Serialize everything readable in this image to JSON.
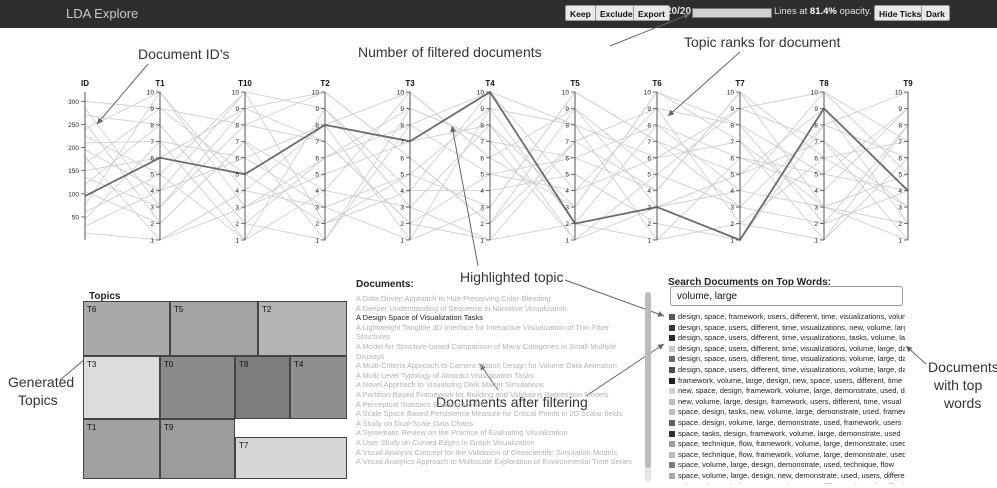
{
  "header": {
    "app_title": "LDA Explore",
    "keep_label": "Keep",
    "exclude_label": "Exclude",
    "export_label": "Export",
    "filter_count": "20/20",
    "filter_fraction": 1.0,
    "opacity_prefix": "Lines at ",
    "opacity_value": "81.4%",
    "opacity_suffix": " opacity.",
    "hide_ticks_label": "Hide Ticks",
    "dark_label": "Dark"
  },
  "annotations": {
    "document_ids": "Document ID’s",
    "filtered_documents": "Number of filtered documents",
    "topic_ranks": "Topic ranks for document",
    "highlighted_topic": "Highlighted topic",
    "documents_after_filtering": "Documents after filtering",
    "generated_topics_1": "Generated",
    "generated_topics_2": "Topics",
    "documents_top_1": "Documents",
    "documents_top_2": "with top",
    "documents_top_3": "words"
  },
  "chart_data": {
    "type": "parallel-coordinates",
    "axes": [
      {
        "name": "ID",
        "ticks": [
          50,
          100,
          150,
          200,
          250,
          300
        ],
        "range": [
          0,
          320
        ]
      },
      {
        "name": "T1",
        "ticks": [
          1,
          2,
          3,
          4,
          5,
          6,
          7,
          8,
          9,
          10
        ],
        "range": [
          1,
          10
        ]
      },
      {
        "name": "T10",
        "ticks": [
          1,
          2,
          3,
          4,
          5,
          6,
          7,
          8,
          9,
          10
        ],
        "range": [
          1,
          10
        ]
      },
      {
        "name": "T2",
        "ticks": [
          1,
          2,
          3,
          4,
          5,
          6,
          7,
          8,
          9,
          10
        ],
        "range": [
          1,
          10
        ]
      },
      {
        "name": "T3",
        "ticks": [
          1,
          2,
          3,
          4,
          5,
          6,
          7,
          8,
          9,
          10
        ],
        "range": [
          1,
          10
        ]
      },
      {
        "name": "T4",
        "ticks": [
          1,
          2,
          3,
          4,
          5,
          6,
          7,
          8,
          9,
          10
        ],
        "range": [
          1,
          10
        ]
      },
      {
        "name": "T5",
        "ticks": [
          1,
          2,
          3,
          4,
          5,
          6,
          7,
          8,
          9,
          10
        ],
        "range": [
          1,
          10
        ]
      },
      {
        "name": "T6",
        "ticks": [
          1,
          2,
          3,
          4,
          5,
          6,
          7,
          8,
          9,
          10
        ],
        "range": [
          1,
          10
        ]
      },
      {
        "name": "T7",
        "ticks": [
          1,
          2,
          3,
          4,
          5,
          6,
          7,
          8,
          9,
          10
        ],
        "range": [
          1,
          10
        ]
      },
      {
        "name": "T8",
        "ticks": [
          1,
          2,
          3,
          4,
          5,
          6,
          7,
          8,
          9,
          10
        ],
        "range": [
          1,
          10
        ]
      },
      {
        "name": "T9",
        "ticks": [
          1,
          2,
          3,
          4,
          5,
          6,
          7,
          8,
          9,
          10
        ],
        "range": [
          1,
          10
        ]
      }
    ],
    "highlighted": [
      95,
      6,
      5,
      8,
      7,
      10,
      2,
      3,
      1,
      9,
      4
    ],
    "lines": [
      [
        300,
        9,
        8,
        7,
        2,
        5,
        6,
        4,
        10,
        3,
        1
      ],
      [
        285,
        3,
        9,
        10,
        6,
        2,
        7,
        9,
        8,
        5,
        4
      ],
      [
        270,
        8,
        2,
        6,
        9,
        7,
        1,
        3,
        4,
        10,
        5
      ],
      [
        255,
        2,
        7,
        1,
        8,
        10,
        4,
        6,
        9,
        7,
        3
      ],
      [
        240,
        10,
        4,
        3,
        5,
        9,
        8,
        1,
        2,
        6,
        7
      ],
      [
        225,
        5,
        10,
        9,
        3,
        1,
        2,
        8,
        6,
        4,
        9
      ],
      [
        210,
        7,
        1,
        4,
        10,
        6,
        9,
        5,
        3,
        2,
        8
      ],
      [
        195,
        4,
        6,
        8,
        1,
        3,
        10,
        7,
        5,
        9,
        2
      ],
      [
        180,
        1,
        3,
        5,
        7,
        8,
        3,
        10,
        7,
        1,
        6
      ],
      [
        165,
        9,
        5,
        2,
        4,
        4,
        5,
        2,
        1,
        8,
        10
      ],
      [
        150,
        6,
        9,
        7,
        2,
        1,
        7,
        4,
        10,
        6,
        3
      ],
      [
        135,
        3,
        8,
        10,
        6,
        2,
        9,
        3,
        5,
        7,
        1
      ],
      [
        120,
        8,
        2,
        1,
        9,
        7,
        6,
        8,
        4,
        3,
        5
      ],
      [
        105,
        2,
        7,
        4,
        3,
        8,
        1,
        5,
        9,
        10,
        7
      ],
      [
        75,
        10,
        3,
        6,
        8,
        5,
        4,
        9,
        2,
        1,
        8
      ],
      [
        60,
        5,
        1,
        9,
        4,
        10,
        8,
        6,
        7,
        3,
        2
      ],
      [
        45,
        7,
        6,
        3,
        1,
        9,
        2,
        1,
        6,
        5,
        9
      ],
      [
        30,
        4,
        10,
        2,
        5,
        3,
        10,
        7,
        3,
        8,
        6
      ],
      [
        15,
        1,
        4,
        8,
        10,
        6,
        3,
        10,
        8,
        2,
        4
      ]
    ]
  },
  "treemap": {
    "title": "Topics",
    "tiles": [
      {
        "label": "T6",
        "color": "#a9a9a9"
      },
      {
        "label": "T5",
        "color": "#a3a3a3"
      },
      {
        "label": "T2",
        "color": "#b4b4b4"
      },
      {
        "label": "T3",
        "color": "#dcdcdc"
      },
      {
        "label": "T0",
        "color": "#8a8a8a"
      },
      {
        "label": "T8",
        "color": "#7d7d7d"
      },
      {
        "label": "T4",
        "color": "#8f8f8f"
      },
      {
        "label": "T1",
        "color": "#a0a0a0"
      },
      {
        "label": "T9",
        "color": "#9c9c9c"
      },
      {
        "label": "T7",
        "color": "#d6d6d6"
      }
    ]
  },
  "documents": {
    "title": "Documents:",
    "items": [
      {
        "text": "A Data-Driven Approach to Hue-Preserving Color-Blending",
        "hl": false
      },
      {
        "text": "A Deeper Understanding of Sequence in Narrative Visualization",
        "hl": false
      },
      {
        "text": "A Design Space of Visualization Tasks",
        "hl": true
      },
      {
        "text": "A Lightweight Tangible 3D Interface for Interactive Visualization of Thin Fiber",
        "hl": false
      },
      {
        "text": "Structures",
        "hl": false
      },
      {
        "text": "A Model for Structure-based Comparison of Many Categories in Small-Multiple",
        "hl": false
      },
      {
        "text": "Displays",
        "hl": false
      },
      {
        "text": "A Multi-Criteria Approach to Camera Motion Design for Volume Data Animation",
        "hl": false
      },
      {
        "text": "A Multi-Level Typology of Abstract Visualization Tasks",
        "hl": false
      },
      {
        "text": "A Novel Approach to Visualizing Dark Matter Simulations",
        "hl": false
      },
      {
        "text": "A Partition-Based Framework for Building and Validating Regression Models",
        "hl": false
      },
      {
        "text": "A Perceptual Statistics Shading Model",
        "hl": false
      },
      {
        "text": "A Scale Space Based Persistence Measure for Critical Points in 2D Scalar fields",
        "hl": false
      },
      {
        "text": "A Study on Dual-Scale Data Charts",
        "hl": false
      },
      {
        "text": "A Systematic Review on the Practice of Evaluating Visualization",
        "hl": false
      },
      {
        "text": "A User Study on Curved Edges in Graph Visualization",
        "hl": false
      },
      {
        "text": "A Visual Analysis Concept for the Validation of Geoscientific Simulation Models",
        "hl": false
      },
      {
        "text": "A Visual Analytics Approach to Multiscale Exploration of Environmental Time Series",
        "hl": false
      }
    ]
  },
  "search": {
    "title": "Search Documents on Top Words:",
    "value": "volume, large",
    "results": [
      {
        "text": "design, space, framework, users, different, time, visualizations, volume",
        "color": "#5a5a5a"
      },
      {
        "text": "design, space, users, different, time, visualizations, new, volume, large",
        "color": "#3a3a3a"
      },
      {
        "text": "design, space, users, different, time, visualizations, tasks, volume, large",
        "color": "#2a2a2a"
      },
      {
        "text": "design, space, users, different, time, visualizations, volume, large, data",
        "color": "#c8c8c8"
      },
      {
        "text": "design, space, users, different, time, visualizations, volume, large, data",
        "color": "#6a6a6a"
      },
      {
        "text": "design, space, users, different, time, visualizations, volume, large, data",
        "color": "#4a4a4a"
      },
      {
        "text": "framework, volume, large, design, new, space, users, different, time",
        "color": "#1f1f1f"
      },
      {
        "text": "new, space, design, framework, volume, large, demonstrate, used, data",
        "color": "#d0d0d0"
      },
      {
        "text": "new, volume, large, design, framework, users, different, time, visual",
        "color": "#bdbdbd"
      },
      {
        "text": "space, design, tasks, new, volume, large, demonstrate, used, framework",
        "color": "#bdbdbd"
      },
      {
        "text": "space, design, volume, large, demonstrate, used, framework, users",
        "color": "#5f5f5f"
      },
      {
        "text": "space, tasks, design, framework, volume, large, demonstrate, used",
        "color": "#2f2f2f"
      },
      {
        "text": "space, technique, flow, framework, volume, large, demonstrate, used",
        "color": "#9c9c9c"
      },
      {
        "text": "space, technique, flow, framework, volume, large, demonstrate, used",
        "color": "#bcbcbc"
      },
      {
        "text": "space, volume, large, design, demonstrate, used, technique, flow",
        "color": "#7c7c7c"
      },
      {
        "text": "space, volume, large, design, new, demonstrate, used, users, different",
        "color": "#aaaaaa"
      },
      {
        "text": "volume, large, design, space, tasks, users, different, time, visualization",
        "color": "#333333"
      }
    ]
  }
}
